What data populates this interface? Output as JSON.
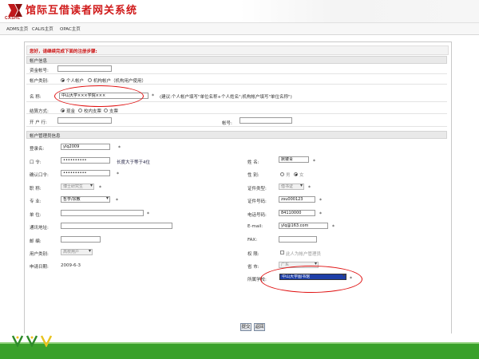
{
  "header": {
    "logo_text": "CASHL",
    "title": "馆际互借读者网关系统"
  },
  "nav": {
    "items": [
      "ADMS主页",
      "CALIS主页",
      "OPAC主页"
    ]
  },
  "notice": "您好，请继续完成下面的注册步骤:",
  "account_section": {
    "title": "帐户信息",
    "fund_account_label": "资金帐号:",
    "fund_account_value": "",
    "type_label": "帐户类别:",
    "type_personal": "个人帐户",
    "type_org": "机构帐户（机构用户使用）",
    "name_label": "名 称:",
    "name_value": "中山大学×××学院×××",
    "name_hint": "(建议:个人帐户填写\"单位名称+个人姓名\";机构帐户填写\"单位名称\")",
    "settle_label": "结算方式:",
    "settle_cash": "现金",
    "settle_school": "校内支票",
    "settle_other": "支票",
    "bank_label": "开 户 行:",
    "bank_value": "",
    "acct_no_label": "帐号:",
    "acct_no_value": ""
  },
  "admin_section": {
    "title": "帐户管理员信息",
    "login_label": "登录名:",
    "login_value": "ylq2009",
    "password_label": "口 令:",
    "password_value": "••••••••••",
    "password_hint": "长度大于等于4位",
    "confirm_label": "确认口令:",
    "confirm_value": "••••••••••",
    "title_label": "职 称:",
    "title_value": "博士研究生",
    "major_label": "专 业:",
    "major_value": "哲学/宗教",
    "unit_label": "单 位:",
    "unit_value": "",
    "address_label": "通讯地址:",
    "address_value": "",
    "zip_label": "邮 编:",
    "zip_value": "",
    "usertype_label": "用户类别:",
    "usertype_value": "高校用户",
    "date_label": "申请日期:",
    "date_value": "2009-6-3",
    "realname_label": "姓 名:",
    "realname_value": "默镂青",
    "gender_label": "性 别:",
    "gender_male": "男",
    "gender_female": "女",
    "idtype_label": "证件类型:",
    "idtype_value": "借书证",
    "idno_label": "证件号码:",
    "idno_value": "zsu000123",
    "phone_label": "电话号码:",
    "phone_value": "84110000",
    "email_label": "E-mail:",
    "email_value": "ylq@163.com",
    "fax_label": "FAX:",
    "fax_value": "",
    "perm_label": "权 限:",
    "perm_value": "此人为帐户管理员",
    "province_label": "省 市:",
    "province_value": "广东",
    "library_label": "所属学校:",
    "library_value": "中山大学图书馆"
  },
  "buttons": {
    "submit": "提交",
    "back": "返回"
  },
  "colors": {
    "title_red": "#d01a1a",
    "footer_green": "#3aa12b",
    "highlight_red": "#e01010"
  }
}
